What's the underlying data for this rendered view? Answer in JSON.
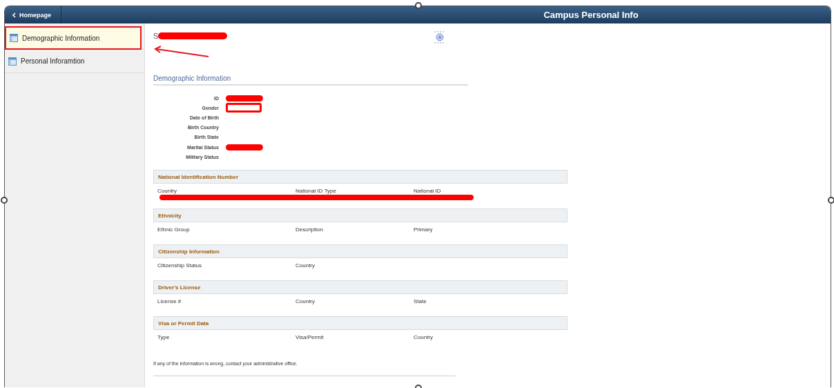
{
  "header": {
    "back_button": "Homepage",
    "title": "Campus Personal Info"
  },
  "sidebar": {
    "items": [
      {
        "label": "Demographic Information",
        "selected": true
      },
      {
        "label": "Personal Inforamtion",
        "selected": false
      }
    ]
  },
  "student_name": {
    "text": "S",
    "kind": "redacted"
  },
  "demographic": {
    "title": "Demographic Information",
    "fields": [
      {
        "label": "ID",
        "kind": "redacted"
      },
      {
        "label": "Gender",
        "kind": "outlined"
      },
      {
        "label": "Date of Birth",
        "kind": "plain"
      },
      {
        "label": "Birth Country",
        "kind": "plain"
      },
      {
        "label": "Birth State",
        "kind": "plain"
      },
      {
        "label": "Marital Status",
        "kind": "redacted"
      },
      {
        "label": "Military Status",
        "kind": "plain"
      }
    ]
  },
  "groups": [
    {
      "title": "National Identification Number",
      "columns": [
        "Country",
        "National ID Type",
        "National ID"
      ],
      "kind": "redacted"
    },
    {
      "title": "Ethnicity",
      "columns": [
        "Ethnic Group",
        "Description",
        "Primary"
      ],
      "kind": "plain"
    },
    {
      "title": "Citizenship Information",
      "columns": [
        "Citizenship Status",
        "Country"
      ],
      "kind": "plain"
    },
    {
      "title": "Driver's License",
      "columns": [
        "License #",
        "Country",
        "State"
      ],
      "kind": "plain"
    },
    {
      "title": "Visa or Permit Data",
      "columns": [
        "Type",
        "Visa/Permit",
        "Country"
      ],
      "kind": "plain"
    }
  ],
  "footer_note": "If any of the information is wrong, contact your administrative office."
}
